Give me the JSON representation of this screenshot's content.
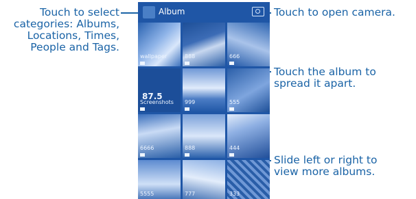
{
  "app": {
    "title": "Album"
  },
  "callouts": {
    "categories": "Touch to select categories: Albums, Locations, Times, People and Tags.",
    "camera": "Touch to open camera.",
    "spread": "Touch the album to spread it apart.",
    "slide": "Slide left or right to view more albums."
  },
  "albums": [
    {
      "label": "wallpaper"
    },
    {
      "label": "888"
    },
    {
      "label": "666"
    },
    {
      "label": "Screenshots"
    },
    {
      "label": "999"
    },
    {
      "label": "555"
    },
    {
      "label": "6666"
    },
    {
      "label": "888"
    },
    {
      "label": "444"
    },
    {
      "label": "5555"
    },
    {
      "label": "777"
    },
    {
      "label": "333"
    }
  ],
  "screenshots_tile": {
    "big_number": "87.5"
  },
  "icons": {
    "app": "gallery-icon",
    "camera": "camera-icon",
    "album_flag": "folder-icon"
  },
  "colors": {
    "accent_text": "#1a63a6",
    "phone_bg": "#1f56a6"
  }
}
